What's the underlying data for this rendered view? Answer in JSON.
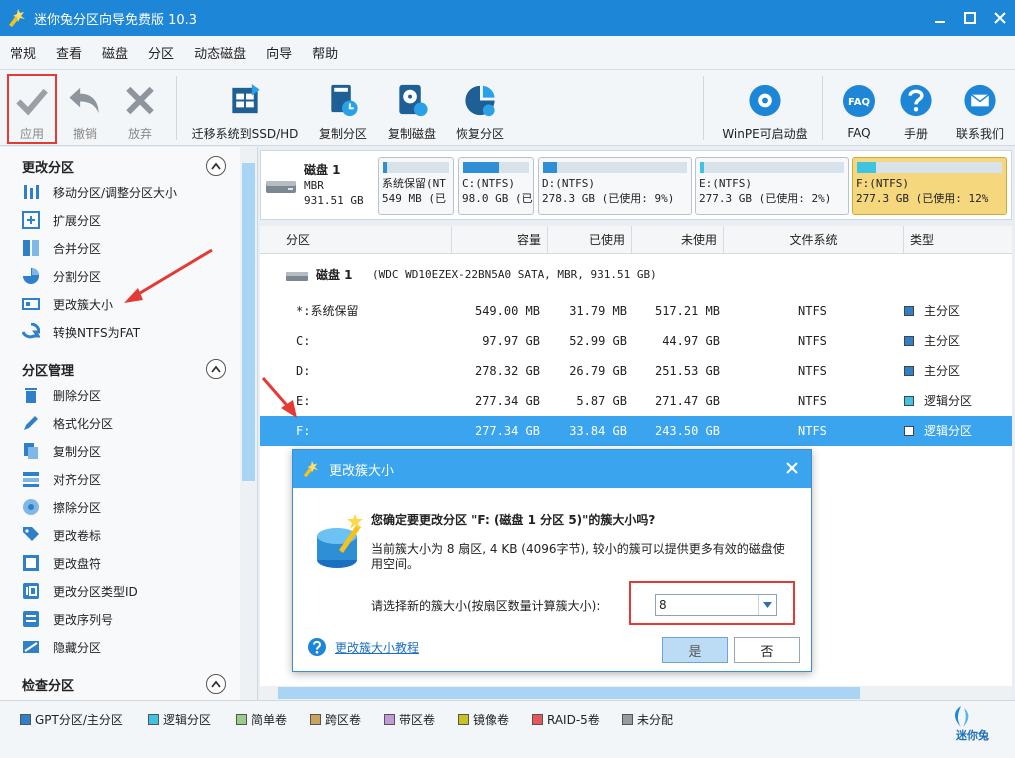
{
  "window": {
    "title": "迷你兔分区向导免费版 10.3"
  },
  "menu": [
    "常规",
    "查看",
    "磁盘",
    "分区",
    "动态磁盘",
    "向导",
    "帮助"
  ],
  "toolbar": {
    "apply": "应用",
    "undo": "撤销",
    "discard": "放弃",
    "migrate": "迁移系统到SSD/HD",
    "copy_partition": "复制分区",
    "copy_disk": "复制磁盘",
    "recover_partition": "恢复分区",
    "winpe": "WinPE可启动盘",
    "faq": "FAQ",
    "manual": "手册",
    "contact": "联系我们",
    "faq_icon_text": "FAQ"
  },
  "left": {
    "change_partition": {
      "title": "更改分区",
      "items": [
        "移动分区/调整分区大小",
        "扩展分区",
        "合并分区",
        "分割分区",
        "更改簇大小",
        "转换NTFS为FAT"
      ]
    },
    "partition_mgmt": {
      "title": "分区管理",
      "items": [
        "删除分区",
        "格式化分区",
        "复制分区",
        "对齐分区",
        "擦除分区",
        "更改卷标",
        "更改盘符",
        "更改分区类型ID",
        "更改序列号",
        "隐藏分区"
      ]
    },
    "check_partition": {
      "title": "检查分区"
    }
  },
  "diskmap": {
    "disk_name": "磁盘 1",
    "disk_type": "MBR",
    "disk_size": "931.51 GB",
    "partitions": [
      {
        "label": "系统保留(NT",
        "info": "549 MB (已",
        "fill": 0.06,
        "color": "#2f8fd6"
      },
      {
        "label": "C:(NTFS)",
        "info": "98.0 GB (已",
        "fill": 0.54,
        "color": "#2f8fd6"
      },
      {
        "label": "D:(NTFS)",
        "info": "278.3 GB (已使用: 9%)",
        "fill": 0.1,
        "color": "#2f8fd6"
      },
      {
        "label": "E:(NTFS)",
        "info": "277.3 GB (已使用: 2%)",
        "fill": 0.03,
        "color": "#3ec3e3"
      },
      {
        "label": "F:(NTFS)",
        "info": "277.3 GB (已使用: 12%",
        "fill": 0.13,
        "color": "#3ec3e3"
      }
    ]
  },
  "table": {
    "headers": [
      "分区",
      "容量",
      "已使用",
      "未使用",
      "文件系统",
      "类型"
    ],
    "disk_row": {
      "name": "磁盘 1",
      "detail": "(WDC WD10EZEX-22BN5A0 SATA, MBR, 931.51 GB)"
    },
    "rows": [
      {
        "name": "*:系统保留",
        "cap": "549.00 MB",
        "used": "31.79 MB",
        "free": "517.21 MB",
        "fs": "NTFS",
        "type": "主分区",
        "tcolor": "#2f7fc9"
      },
      {
        "name": "C:",
        "cap": "97.97 GB",
        "used": "52.99 GB",
        "free": "44.97 GB",
        "fs": "NTFS",
        "type": "主分区",
        "tcolor": "#2f7fc9"
      },
      {
        "name": "D:",
        "cap": "278.32 GB",
        "used": "26.79 GB",
        "free": "251.53 GB",
        "fs": "NTFS",
        "type": "主分区",
        "tcolor": "#2f7fc9"
      },
      {
        "name": "E:",
        "cap": "277.34 GB",
        "used": "5.87 GB",
        "free": "271.47 GB",
        "fs": "NTFS",
        "type": "逻辑分区",
        "tcolor": "#3ec3e3"
      },
      {
        "name": "F:",
        "cap": "277.34 GB",
        "used": "33.84 GB",
        "free": "243.50 GB",
        "fs": "NTFS",
        "type": "逻辑分区",
        "tcolor": "#3ec3e3"
      }
    ]
  },
  "legend": [
    {
      "label": "GPT分区/主分区",
      "color": "#2f7fc9"
    },
    {
      "label": "逻辑分区",
      "color": "#3ec3e3"
    },
    {
      "label": "简单卷",
      "color": "#9ccc8a"
    },
    {
      "label": "跨区卷",
      "color": "#c9a35d"
    },
    {
      "label": "带区卷",
      "color": "#c39ad8"
    },
    {
      "label": "镜像卷",
      "color": "#c8c220"
    },
    {
      "label": "RAID-5卷",
      "color": "#e8555a"
    },
    {
      "label": "未分配",
      "color": "#9a9a9a"
    }
  ],
  "brand": "迷你兔",
  "dialog": {
    "title": "更改簇大小",
    "question": "您确定要更改分区 \"F: (磁盘 1 分区 5)\"的簇大小吗?",
    "info": "当前簇大小为 8 扇区, 4 KB (4096字节), 较小的簇可以提供更多有效的磁盘使用空间。",
    "select_label": "请选择新的簇大小(按扇区数量计算簇大小):",
    "selected_value": "8",
    "help_link": "更改簇大小教程",
    "yes": "是",
    "no": "否"
  }
}
